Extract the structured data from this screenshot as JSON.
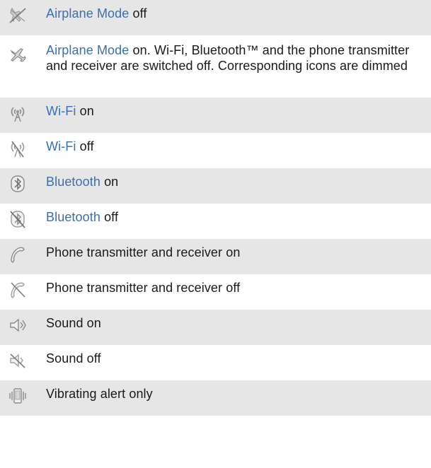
{
  "rows": [
    {
      "icon": "airplane-mode-off-icon",
      "link": "Airplane Mode",
      "text": " off"
    },
    {
      "icon": "airplane-mode-on-icon",
      "link": "Airplane Mode",
      "text": " on. Wi-Fi, Bluetooth™ and the phone transmitter and receiver are switched off. Corresponding icons are dimmed"
    },
    {
      "icon": "wifi-on-icon",
      "link": "Wi-Fi",
      "text": " on"
    },
    {
      "icon": "wifi-off-icon",
      "link": "Wi-Fi",
      "text": " off"
    },
    {
      "icon": "bluetooth-on-icon",
      "link": "Bluetooth",
      "text": " on"
    },
    {
      "icon": "bluetooth-off-icon",
      "link": "Bluetooth",
      "text": " off"
    },
    {
      "icon": "phone-on-icon",
      "link": "",
      "text": "Phone transmitter and receiver on"
    },
    {
      "icon": "phone-off-icon",
      "link": "",
      "text": "Phone transmitter and receiver off"
    },
    {
      "icon": "sound-on-icon",
      "link": "",
      "text": "Sound on"
    },
    {
      "icon": "sound-off-icon",
      "link": "",
      "text": "Sound off"
    },
    {
      "icon": "vibrating-alert-icon",
      "link": "",
      "text": "Vibrating alert only"
    }
  ]
}
